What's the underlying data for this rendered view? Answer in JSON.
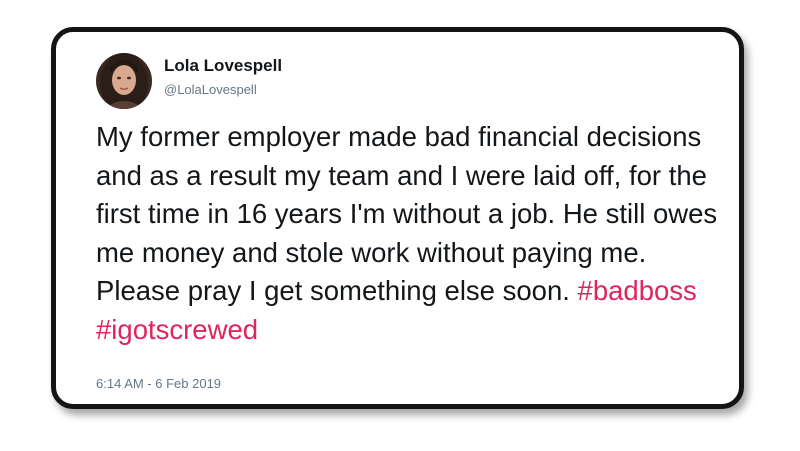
{
  "user": {
    "name": "Lola Lovespell",
    "handle": "@LolaLovespell"
  },
  "tweet": {
    "text": "My former employer made bad financial decisions and as a result my team and I were laid off, for the first time in 16 years I'm without a job. He still owes me money and stole work without paying me. Please pray I get something else soon. ",
    "hashtags": [
      "#badboss",
      "#igotscrewed"
    ],
    "timestamp": "6:14 AM - 6 Feb 2019"
  },
  "colors": {
    "hashtag": "#e0245e",
    "text": "#14171a",
    "secondary": "#657786",
    "frame_border": "#141414"
  }
}
